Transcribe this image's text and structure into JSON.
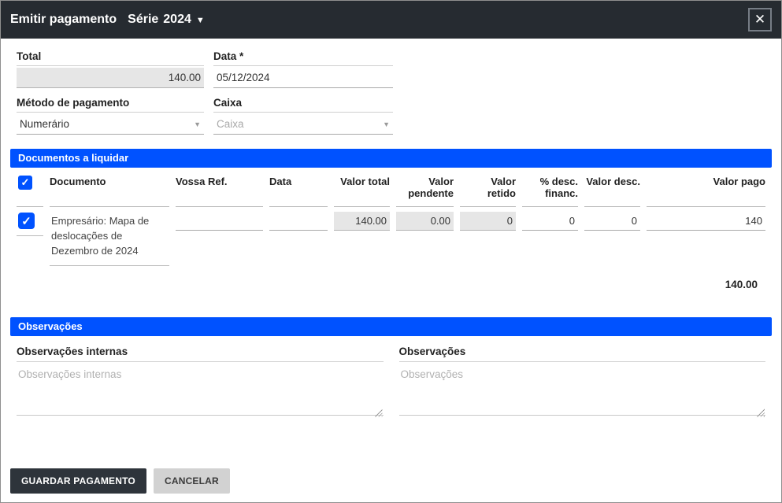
{
  "header": {
    "title": "Emitir pagamento",
    "series_label": "Série",
    "series_value": "2024"
  },
  "icons": {
    "close": "✕",
    "caret_down": "▼",
    "check": "✓"
  },
  "payment": {
    "total_label": "Total",
    "total_value": "140.00",
    "date_label": "Data *",
    "date_value": "05/12/2024",
    "method_label": "Método de pagamento",
    "method_value": "Numerário",
    "cashbox_label": "Caixa",
    "cashbox_value": "Caixa"
  },
  "documents": {
    "section_title": "Documentos a liquidar",
    "columns": {
      "documento": "Documento",
      "vossa_ref": "Vossa Ref.",
      "data": "Data",
      "valor_total": "Valor total",
      "valor_pendente": "Valor pendente",
      "valor_retido": "Valor retido",
      "desc_financ": "% desc. financ.",
      "valor_desc": "Valor desc.",
      "valor_pago": "Valor pago"
    },
    "rows": [
      {
        "documento": "Empresário: Mapa de deslocações de Dezembro de 2024",
        "vossa_ref": "",
        "data": "",
        "valor_total": "140.00",
        "valor_pendente": "0.00",
        "valor_retido": "0",
        "desc_financ": "0",
        "valor_desc": "0",
        "valor_pago": "140"
      }
    ],
    "total": "140.00"
  },
  "observations": {
    "section_title": "Observações",
    "internal_label": "Observações internas",
    "internal_placeholder": "Observações internas",
    "internal_value": "",
    "external_label": "Observações",
    "external_placeholder": "Observações",
    "external_value": ""
  },
  "footer": {
    "save_label": "GUARDAR PAGAMENTO",
    "cancel_label": "CANCELAR"
  },
  "colors": {
    "titlebar_bg": "#262b31",
    "section_bar_bg": "#0052ff",
    "checkbox_accent": "#0052ff",
    "disabled_input_bg": "#e6e6e6",
    "primary_button_bg": "#2e343b",
    "secondary_button_bg": "#d2d2d2"
  }
}
